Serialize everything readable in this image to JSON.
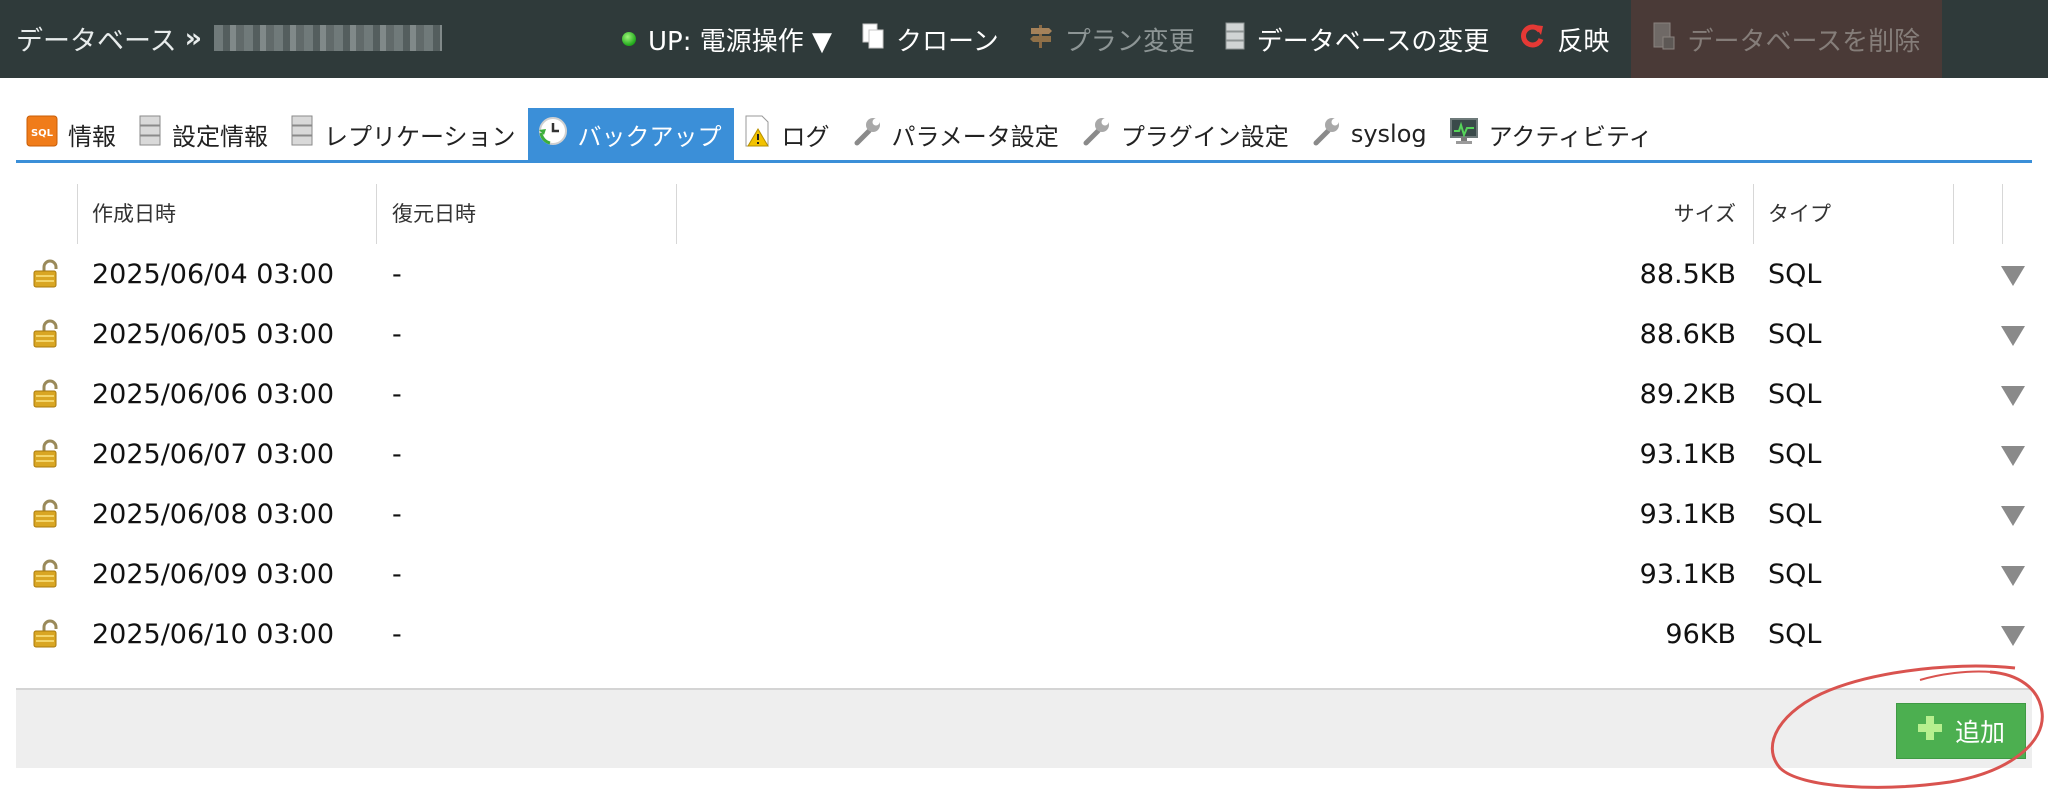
{
  "header": {
    "breadcrumb_root": "データベース",
    "breadcrumb_sep": "»",
    "actions": {
      "power": "UP: 電源操作 ▼",
      "clone": "クローン",
      "plan_change": "プラン変更",
      "db_change": "データベースの変更",
      "apply": "反映",
      "delete": "データベースを削除"
    }
  },
  "tabs": [
    {
      "label": "情報",
      "icon": "sql-icon"
    },
    {
      "label": "設定情報",
      "icon": "server-icon"
    },
    {
      "label": "レプリケーション",
      "icon": "server-icon"
    },
    {
      "label": "バックアップ",
      "icon": "backup-clock-icon"
    },
    {
      "label": "ログ",
      "icon": "log-warning-icon"
    },
    {
      "label": "パラメータ設定",
      "icon": "wrench-icon"
    },
    {
      "label": "プラグイン設定",
      "icon": "wrench-icon"
    },
    {
      "label": "syslog",
      "icon": "wrench-icon"
    },
    {
      "label": "アクティビティ",
      "icon": "monitor-icon"
    }
  ],
  "active_tab": "バックアップ",
  "table": {
    "columns": {
      "created": "作成日時",
      "restored": "復元日時",
      "size": "サイズ",
      "type": "タイプ"
    },
    "rows": [
      {
        "created": "2025/06/04 03:00",
        "restored": "-",
        "size": "88.5KB",
        "type": "SQL"
      },
      {
        "created": "2025/06/05 03:00",
        "restored": "-",
        "size": "88.6KB",
        "type": "SQL"
      },
      {
        "created": "2025/06/06 03:00",
        "restored": "-",
        "size": "89.2KB",
        "type": "SQL"
      },
      {
        "created": "2025/06/07 03:00",
        "restored": "-",
        "size": "93.1KB",
        "type": "SQL"
      },
      {
        "created": "2025/06/08 03:00",
        "restored": "-",
        "size": "93.1KB",
        "type": "SQL"
      },
      {
        "created": "2025/06/09 03:00",
        "restored": "-",
        "size": "93.1KB",
        "type": "SQL"
      },
      {
        "created": "2025/06/10 03:00",
        "restored": "-",
        "size": "96KB",
        "type": "SQL"
      }
    ]
  },
  "footer": {
    "add_label": "追加"
  },
  "colors": {
    "header_bg": "#2f3a3a",
    "tab_active": "#3b8fd8",
    "add_button": "#4caf50",
    "annotation": "#d9534f",
    "delete_bg": "#4a3a37"
  }
}
